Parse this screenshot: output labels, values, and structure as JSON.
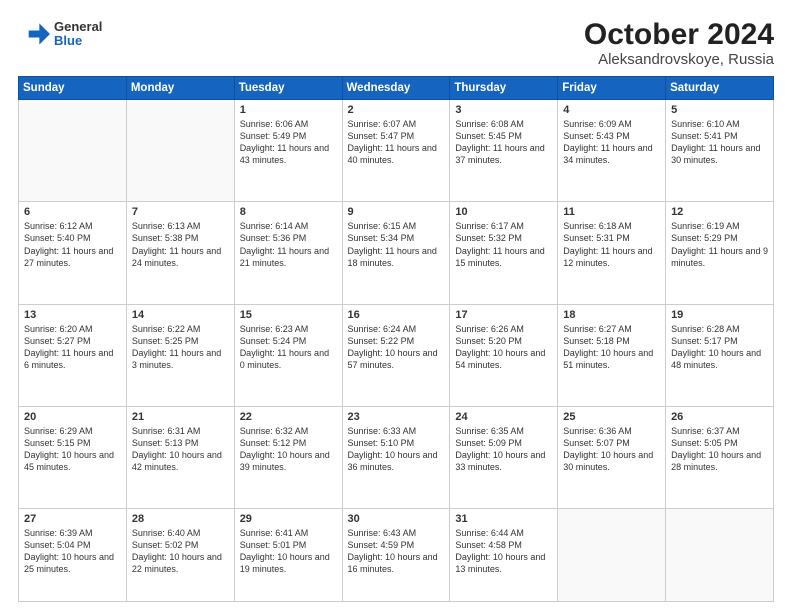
{
  "header": {
    "logo_general": "General",
    "logo_blue": "Blue",
    "title": "October 2024",
    "location": "Aleksandrovskoye, Russia"
  },
  "columns": [
    "Sunday",
    "Monday",
    "Tuesday",
    "Wednesday",
    "Thursday",
    "Friday",
    "Saturday"
  ],
  "weeks": [
    [
      {
        "day": "",
        "text": ""
      },
      {
        "day": "",
        "text": ""
      },
      {
        "day": "1",
        "text": "Sunrise: 6:06 AM\nSunset: 5:49 PM\nDaylight: 11 hours and 43 minutes."
      },
      {
        "day": "2",
        "text": "Sunrise: 6:07 AM\nSunset: 5:47 PM\nDaylight: 11 hours and 40 minutes."
      },
      {
        "day": "3",
        "text": "Sunrise: 6:08 AM\nSunset: 5:45 PM\nDaylight: 11 hours and 37 minutes."
      },
      {
        "day": "4",
        "text": "Sunrise: 6:09 AM\nSunset: 5:43 PM\nDaylight: 11 hours and 34 minutes."
      },
      {
        "day": "5",
        "text": "Sunrise: 6:10 AM\nSunset: 5:41 PM\nDaylight: 11 hours and 30 minutes."
      }
    ],
    [
      {
        "day": "6",
        "text": "Sunrise: 6:12 AM\nSunset: 5:40 PM\nDaylight: 11 hours and 27 minutes."
      },
      {
        "day": "7",
        "text": "Sunrise: 6:13 AM\nSunset: 5:38 PM\nDaylight: 11 hours and 24 minutes."
      },
      {
        "day": "8",
        "text": "Sunrise: 6:14 AM\nSunset: 5:36 PM\nDaylight: 11 hours and 21 minutes."
      },
      {
        "day": "9",
        "text": "Sunrise: 6:15 AM\nSunset: 5:34 PM\nDaylight: 11 hours and 18 minutes."
      },
      {
        "day": "10",
        "text": "Sunrise: 6:17 AM\nSunset: 5:32 PM\nDaylight: 11 hours and 15 minutes."
      },
      {
        "day": "11",
        "text": "Sunrise: 6:18 AM\nSunset: 5:31 PM\nDaylight: 11 hours and 12 minutes."
      },
      {
        "day": "12",
        "text": "Sunrise: 6:19 AM\nSunset: 5:29 PM\nDaylight: 11 hours and 9 minutes."
      }
    ],
    [
      {
        "day": "13",
        "text": "Sunrise: 6:20 AM\nSunset: 5:27 PM\nDaylight: 11 hours and 6 minutes."
      },
      {
        "day": "14",
        "text": "Sunrise: 6:22 AM\nSunset: 5:25 PM\nDaylight: 11 hours and 3 minutes."
      },
      {
        "day": "15",
        "text": "Sunrise: 6:23 AM\nSunset: 5:24 PM\nDaylight: 11 hours and 0 minutes."
      },
      {
        "day": "16",
        "text": "Sunrise: 6:24 AM\nSunset: 5:22 PM\nDaylight: 10 hours and 57 minutes."
      },
      {
        "day": "17",
        "text": "Sunrise: 6:26 AM\nSunset: 5:20 PM\nDaylight: 10 hours and 54 minutes."
      },
      {
        "day": "18",
        "text": "Sunrise: 6:27 AM\nSunset: 5:18 PM\nDaylight: 10 hours and 51 minutes."
      },
      {
        "day": "19",
        "text": "Sunrise: 6:28 AM\nSunset: 5:17 PM\nDaylight: 10 hours and 48 minutes."
      }
    ],
    [
      {
        "day": "20",
        "text": "Sunrise: 6:29 AM\nSunset: 5:15 PM\nDaylight: 10 hours and 45 minutes."
      },
      {
        "day": "21",
        "text": "Sunrise: 6:31 AM\nSunset: 5:13 PM\nDaylight: 10 hours and 42 minutes."
      },
      {
        "day": "22",
        "text": "Sunrise: 6:32 AM\nSunset: 5:12 PM\nDaylight: 10 hours and 39 minutes."
      },
      {
        "day": "23",
        "text": "Sunrise: 6:33 AM\nSunset: 5:10 PM\nDaylight: 10 hours and 36 minutes."
      },
      {
        "day": "24",
        "text": "Sunrise: 6:35 AM\nSunset: 5:09 PM\nDaylight: 10 hours and 33 minutes."
      },
      {
        "day": "25",
        "text": "Sunrise: 6:36 AM\nSunset: 5:07 PM\nDaylight: 10 hours and 30 minutes."
      },
      {
        "day": "26",
        "text": "Sunrise: 6:37 AM\nSunset: 5:05 PM\nDaylight: 10 hours and 28 minutes."
      }
    ],
    [
      {
        "day": "27",
        "text": "Sunrise: 6:39 AM\nSunset: 5:04 PM\nDaylight: 10 hours and 25 minutes."
      },
      {
        "day": "28",
        "text": "Sunrise: 6:40 AM\nSunset: 5:02 PM\nDaylight: 10 hours and 22 minutes."
      },
      {
        "day": "29",
        "text": "Sunrise: 6:41 AM\nSunset: 5:01 PM\nDaylight: 10 hours and 19 minutes."
      },
      {
        "day": "30",
        "text": "Sunrise: 6:43 AM\nSunset: 4:59 PM\nDaylight: 10 hours and 16 minutes."
      },
      {
        "day": "31",
        "text": "Sunrise: 6:44 AM\nSunset: 4:58 PM\nDaylight: 10 hours and 13 minutes."
      },
      {
        "day": "",
        "text": ""
      },
      {
        "day": "",
        "text": ""
      }
    ]
  ]
}
